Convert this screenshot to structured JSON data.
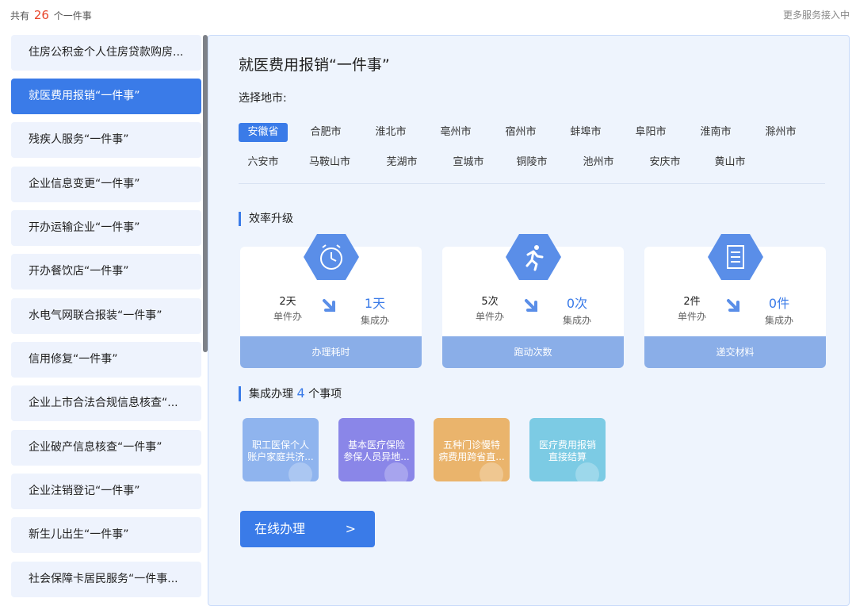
{
  "header": {
    "count_prefix": "共有",
    "count_value": "26",
    "count_suffix": "个一件事",
    "more_services": "更多服务接入中"
  },
  "sidebar": {
    "items": [
      {
        "label": "住房公积金个人住房贷款购房...",
        "active": false
      },
      {
        "label": "就医费用报销“一件事”",
        "active": true
      },
      {
        "label": "残疾人服务“一件事”",
        "active": false
      },
      {
        "label": "企业信息变更“一件事”",
        "active": false
      },
      {
        "label": "开办运输企业“一件事”",
        "active": false
      },
      {
        "label": "开办餐饮店“一件事”",
        "active": false
      },
      {
        "label": "水电气网联合报装“一件事”",
        "active": false
      },
      {
        "label": "信用修复“一件事”",
        "active": false
      },
      {
        "label": "企业上市合法合规信息核查“...",
        "active": false
      },
      {
        "label": "企业破产信息核查“一件事”",
        "active": false
      },
      {
        "label": "企业注销登记“一件事”",
        "active": false
      },
      {
        "label": "新生儿出生“一件事”",
        "active": false
      },
      {
        "label": "社会保障卡居民服务“一件事...",
        "active": false
      }
    ]
  },
  "main": {
    "title": "就医费用报销“一件事”",
    "city_label": "选择地市:",
    "cities_row1": [
      "安徽省",
      "合肥市",
      "淮北市",
      "亳州市",
      "宿州市",
      "蚌埠市",
      "阜阳市",
      "淮南市",
      "滁州市"
    ],
    "cities_row2": [
      "六安市",
      "马鞍山市",
      "芜湖市",
      "宣城市",
      "铜陵市",
      "池州市",
      "安庆市",
      "黄山市"
    ],
    "selected_city": "安徽省",
    "efficiency_title": "效率升级",
    "cards": [
      {
        "icon": "clock-icon",
        "before_value": "2天",
        "before_label": "单件办",
        "after_value": "1天",
        "after_label": "集成办",
        "footer": "办理耗时"
      },
      {
        "icon": "running-person-icon",
        "before_value": "5次",
        "before_label": "单件办",
        "after_value": "0次",
        "after_label": "集成办",
        "footer": "跑动次数"
      },
      {
        "icon": "document-icon",
        "before_value": "2件",
        "before_label": "单件办",
        "after_value": "0件",
        "after_label": "集成办",
        "footer": "递交材料"
      }
    ],
    "integrated_prefix": "集成办理",
    "integrated_count": "4",
    "integrated_suffix": "个事项",
    "tiles": [
      {
        "line1": "职工医保个人",
        "line2": "账户家庭共济...",
        "color": "#8fb4ee"
      },
      {
        "line1": "基本医疗保险",
        "line2": "参保人员异地...",
        "color": "#8a86e8"
      },
      {
        "line1": "五种门诊慢特",
        "line2": "病费用跨省直...",
        "color": "#eab46c"
      },
      {
        "line1": "医疗费用报销",
        "line2": "直接结算",
        "color": "#7ccbe4"
      }
    ],
    "online_button": "在线办理"
  },
  "colors": {
    "accent": "#3a7be8",
    "count_highlight": "#e8472c",
    "card_footer": "#8aaee8"
  }
}
